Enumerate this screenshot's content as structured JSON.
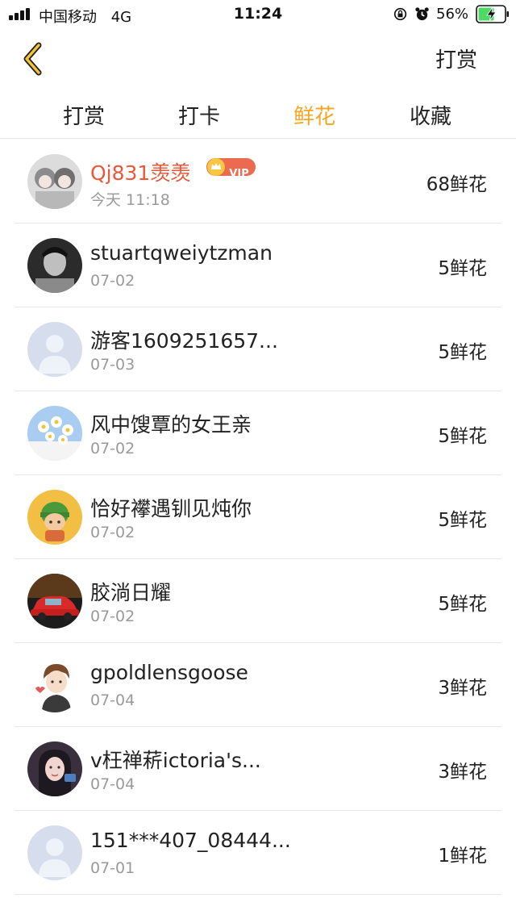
{
  "status_bar": {
    "carrier": "中国移动",
    "network": "4G",
    "time": "11:24",
    "battery": "56%"
  },
  "nav": {
    "back_icon": "chevron-left-icon",
    "action_label": "打赏",
    "accent_color": "#f5a623"
  },
  "tabs": [
    {
      "label": "打赏",
      "active": false
    },
    {
      "label": "打卡",
      "active": false
    },
    {
      "label": "鲜花",
      "active": true
    },
    {
      "label": "收藏",
      "active": false
    }
  ],
  "vip_label": "VIP",
  "list": [
    {
      "name": "Qj831羡羡",
      "date": "今天 11:18",
      "count": "68鲜花",
      "vip": true
    },
    {
      "name": "stuartqweiytzman",
      "date": "07-02",
      "count": "5鲜花"
    },
    {
      "name": "游客1609251657...",
      "date": "07-03",
      "count": "5鲜花"
    },
    {
      "name": "风中馊覃的女王亲",
      "date": "07-02",
      "count": "5鲜花"
    },
    {
      "name": "恰好襻遇钏见炖你",
      "date": "07-02",
      "count": "5鲜花"
    },
    {
      "name": "胶淌日耀",
      "date": "07-02",
      "count": "5鲜花"
    },
    {
      "name": "gpoldlensgoose",
      "date": "07-04",
      "count": "3鲜花"
    },
    {
      "name": "v枉禅菥ictoria's...",
      "date": "07-04",
      "count": "3鲜花"
    },
    {
      "name": "151***407_08444...",
      "date": "07-01",
      "count": "1鲜花"
    }
  ]
}
